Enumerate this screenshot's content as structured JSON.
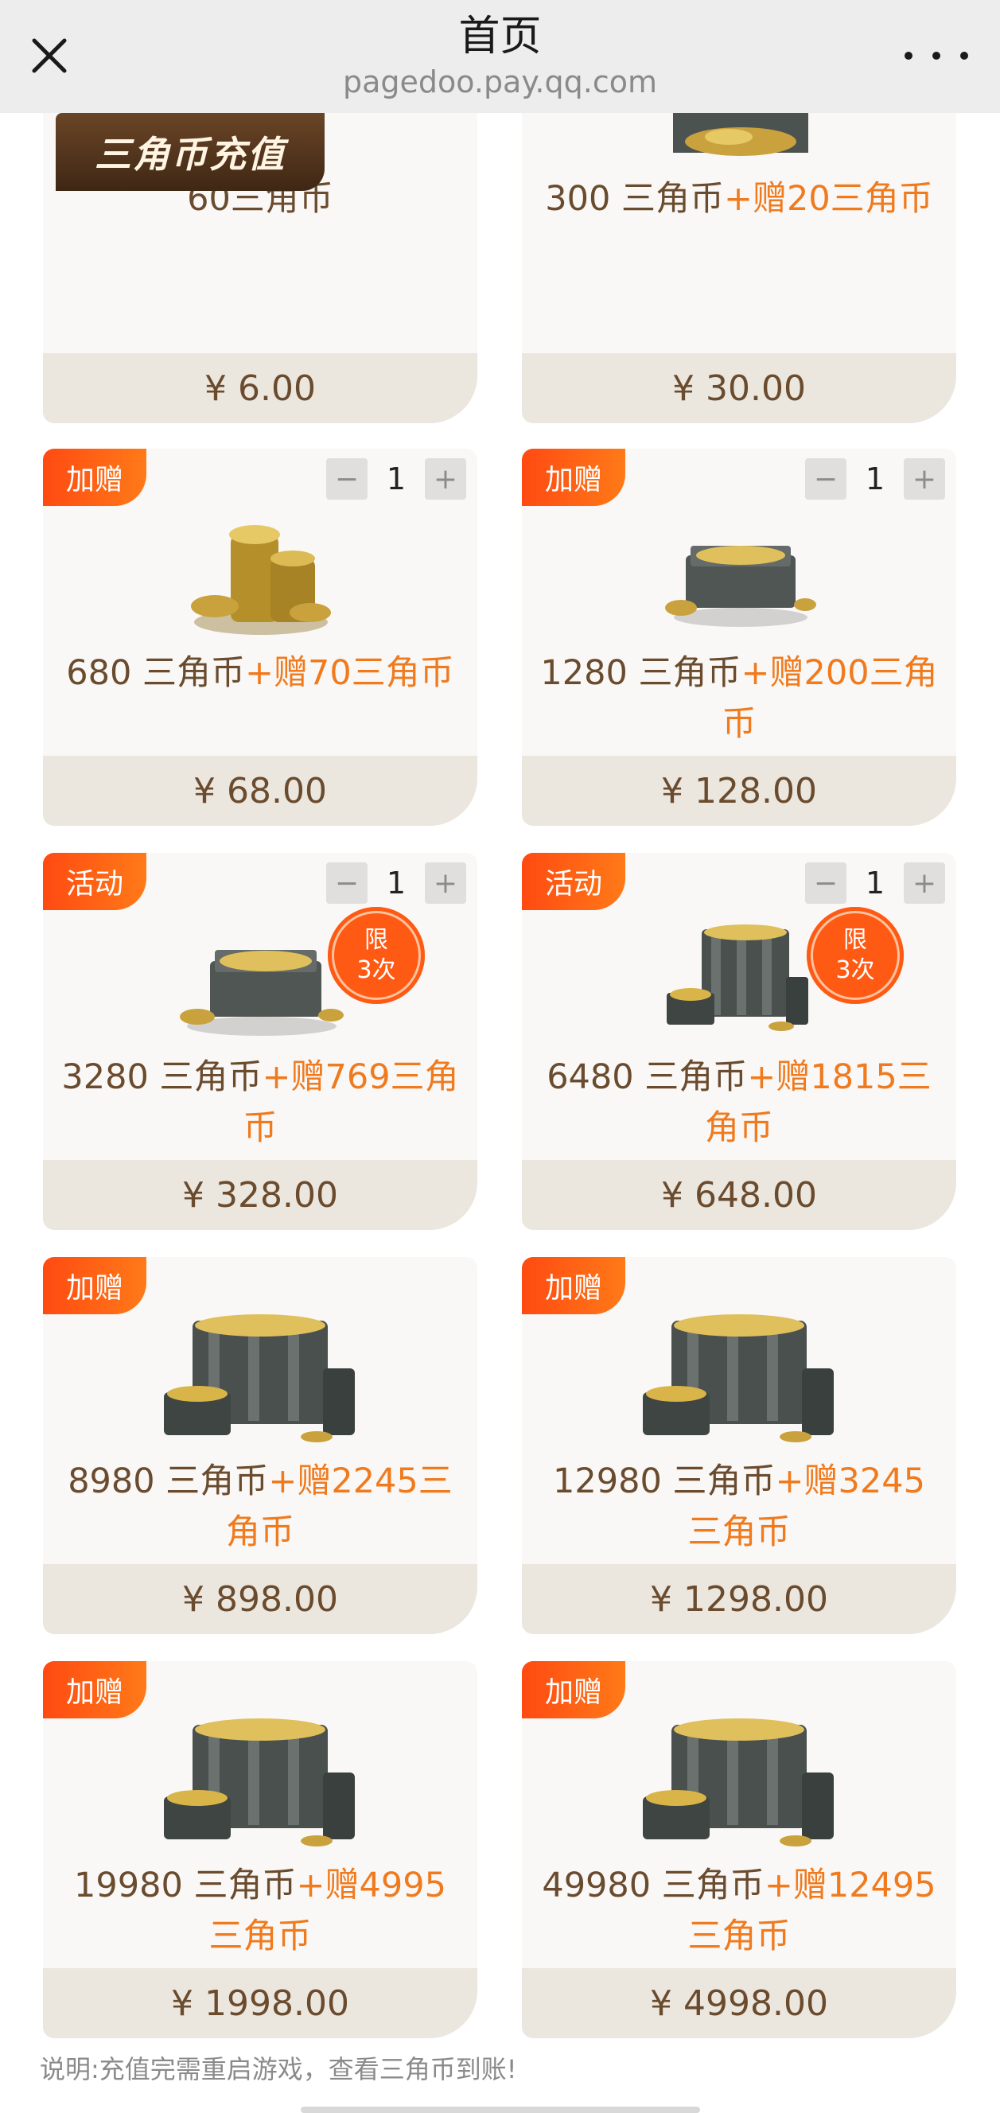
{
  "header": {
    "title": "首页",
    "url": "pagedoo.pay.qq.com"
  },
  "section": {
    "title": "三角币充值"
  },
  "packages": [
    {
      "coins": "60三角币",
      "bonus": "",
      "price": "¥ 6.00"
    },
    {
      "coins": "300 三角币",
      "bonus": "+赠20三角币",
      "price": "¥ 30.00"
    },
    {
      "badge": "加赠",
      "qty": "1",
      "coins": "680 三角币",
      "bonus": "+赠70三角币",
      "price": "¥ 68.00"
    },
    {
      "badge": "加赠",
      "qty": "1",
      "coins": "1280 三角币",
      "bonus": "+赠200三角币",
      "price": "¥ 128.00"
    },
    {
      "badge": "活动",
      "qty": "1",
      "limit": [
        "限",
        "3次"
      ],
      "coins": "3280 三角币",
      "bonus": "+赠769三角币",
      "price": "¥ 328.00"
    },
    {
      "badge": "活动",
      "qty": "1",
      "limit": [
        "限",
        "3次"
      ],
      "coins": "6480 三角币",
      "bonus": "+赠1815三角币",
      "price": "¥ 648.00"
    },
    {
      "badge": "加赠",
      "coins": "8980 三角币",
      "bonus": "+赠2245三角币",
      "price": "¥ 898.00"
    },
    {
      "badge": "加赠",
      "coins": "12980 三角币",
      "bonus": "+赠3245三角币",
      "price": "¥ 1298.00"
    },
    {
      "badge": "加赠",
      "coins": "19980 三角币",
      "bonus": "+赠4995三角币",
      "price": "¥ 1998.00"
    },
    {
      "badge": "加赠",
      "coins": "49980 三角币",
      "bonus": "+赠12495三角币",
      "price": "¥ 4998.00"
    }
  ],
  "stepper": {
    "minus": "−",
    "plus": "+"
  },
  "footer": {
    "note": "说明:充值完需重启游戏，查看三角币到账!"
  }
}
